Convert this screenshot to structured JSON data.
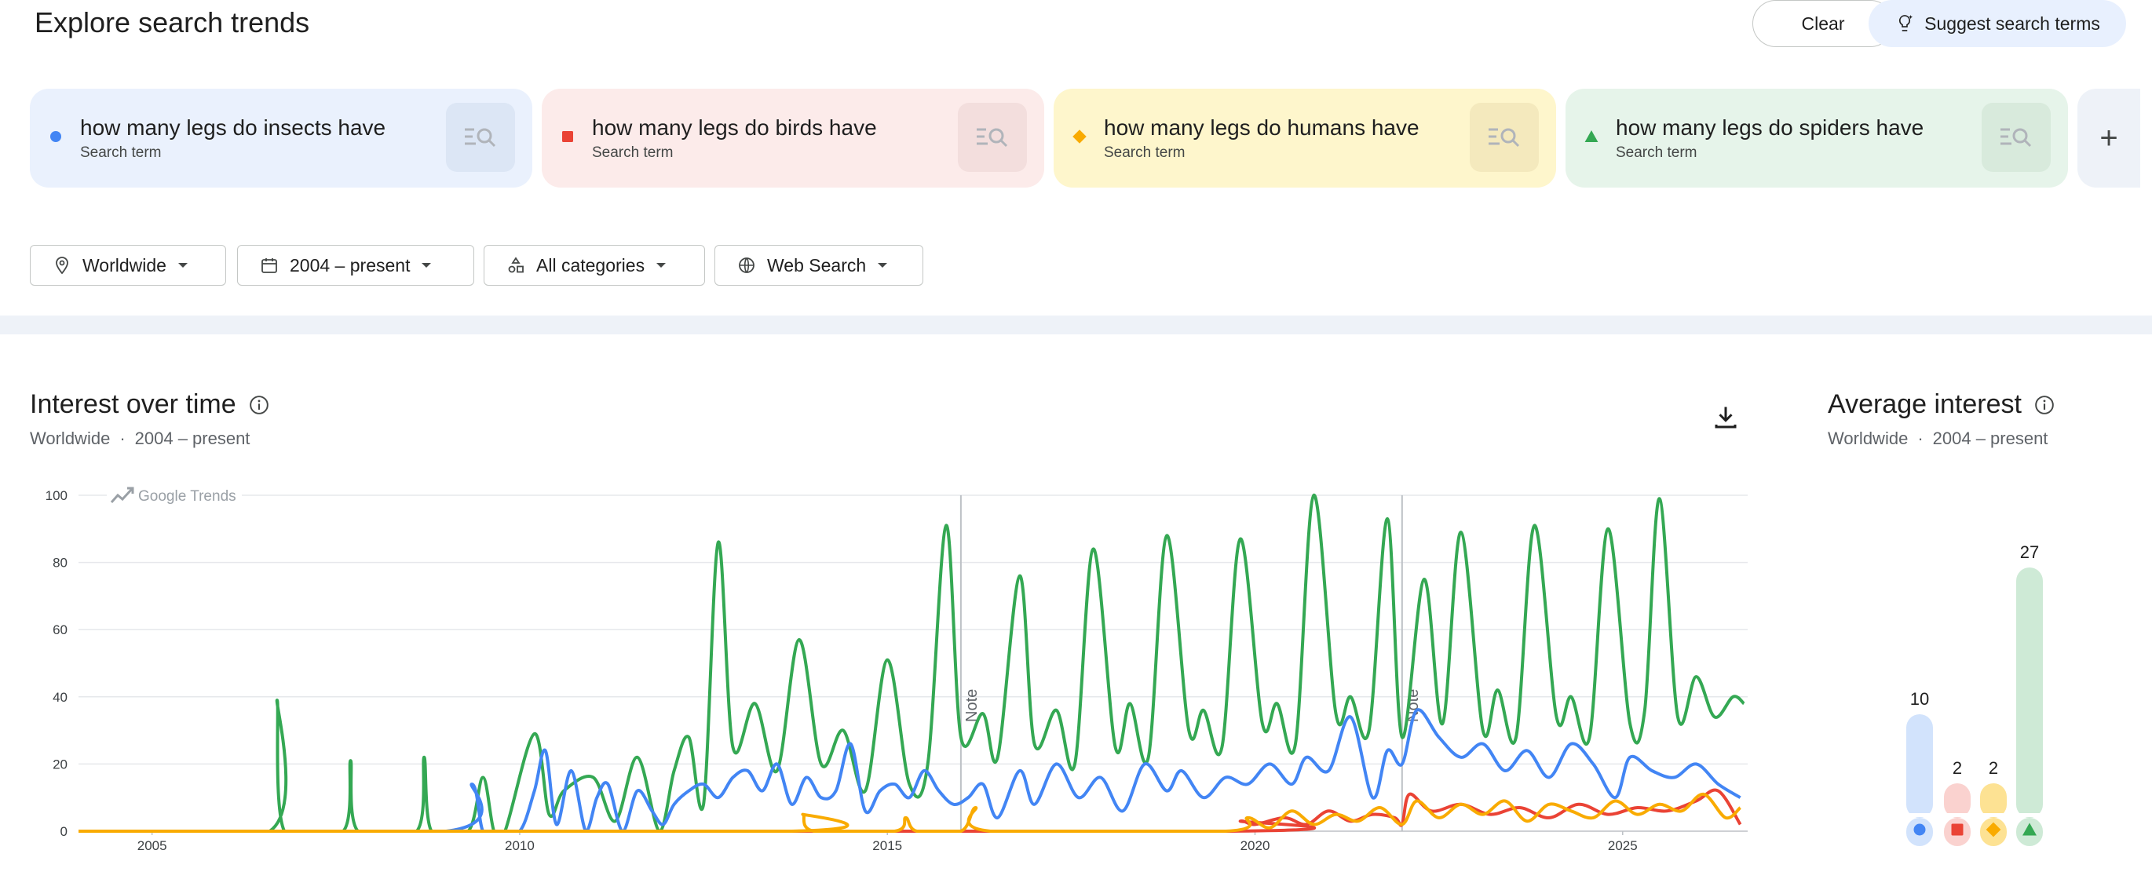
{
  "header": {
    "title": "Explore search trends",
    "clear_label": "Clear",
    "suggest_label": "Suggest search terms"
  },
  "terms": [
    {
      "label": "how many legs do insects have",
      "sub": "Search term",
      "color": "#4285f4",
      "bg": "#eaf1fd",
      "tile": "#dce6f5",
      "marker": "circle"
    },
    {
      "label": "how many legs do birds have",
      "sub": "Search term",
      "color": "#ea4335",
      "bg": "#fcebea",
      "tile": "#f3dedd",
      "marker": "square"
    },
    {
      "label": "how many legs do humans have",
      "sub": "Search term",
      "color": "#f9ab00",
      "bg": "#fef6cc",
      "tile": "#f4e9bd",
      "marker": "diamond"
    },
    {
      "label": "how many legs do spiders have",
      "sub": "Search term",
      "color": "#34a853",
      "bg": "#e6f4ea",
      "tile": "#d8eadc",
      "marker": "triangle"
    }
  ],
  "filters": {
    "location": "Worldwide",
    "time": "2004 – present",
    "category": "All categories",
    "property": "Web Search"
  },
  "interest_over_time": {
    "title": "Interest over time",
    "subtitle_location": "Worldwide",
    "subtitle_sep": "·",
    "subtitle_time": "2004 – present",
    "watermark": "Google Trends"
  },
  "average_interest": {
    "title": "Average interest",
    "subtitle_location": "Worldwide",
    "subtitle_sep": "·",
    "subtitle_time": "2004 – present"
  },
  "chart_data": [
    {
      "type": "line",
      "title": "Interest over time",
      "ylim": [
        0,
        100
      ],
      "yticks": [
        0,
        20,
        40,
        60,
        80,
        100
      ],
      "xlim": [
        2004.0,
        2026.7
      ],
      "xticks": [
        2005,
        2010,
        2015,
        2020,
        2025
      ],
      "grid": true,
      "notes": [
        {
          "x": 2016.0,
          "label": "Note"
        },
        {
          "x": 2022.0,
          "label": "Note"
        }
      ],
      "series": [
        {
          "name": "how many legs do insects have",
          "color": "#4285f4",
          "x": [
            2004.0,
            2009.0,
            2009.35,
            2009.5,
            2009.7,
            2010.0,
            2010.2,
            2010.35,
            2010.5,
            2010.7,
            2010.9,
            2011.05,
            2011.2,
            2011.4,
            2011.6,
            2011.8,
            2011.95,
            2012.1,
            2012.3,
            2012.5,
            2012.7,
            2012.9,
            2013.1,
            2013.3,
            2013.5,
            2013.7,
            2013.9,
            2014.1,
            2014.3,
            2014.5,
            2014.7,
            2014.9,
            2015.1,
            2015.3,
            2015.5,
            2015.7,
            2015.9,
            2016.1,
            2016.3,
            2016.5,
            2016.8,
            2017.0,
            2017.3,
            2017.6,
            2017.9,
            2018.2,
            2018.5,
            2018.8,
            2019.0,
            2019.3,
            2019.6,
            2019.9,
            2020.2,
            2020.5,
            2020.7,
            2021.0,
            2021.3,
            2021.6,
            2021.8,
            2022.0,
            2022.2,
            2022.5,
            2022.8,
            2023.1,
            2023.4,
            2023.7,
            2024.0,
            2024.3,
            2024.6,
            2024.9,
            2025.1,
            2025.4,
            2025.7,
            2026.0,
            2026.3,
            2026.6
          ],
          "y": [
            0,
            0,
            14,
            0,
            0,
            0,
            12,
            24,
            2,
            18,
            0,
            10,
            14,
            0,
            12,
            6,
            2,
            8,
            12,
            14,
            10,
            16,
            18,
            12,
            20,
            8,
            16,
            10,
            12,
            26,
            6,
            12,
            14,
            10,
            18,
            12,
            8,
            10,
            14,
            4,
            18,
            8,
            20,
            10,
            16,
            6,
            20,
            12,
            18,
            10,
            16,
            14,
            20,
            14,
            22,
            18,
            34,
            10,
            24,
            20,
            36,
            28,
            22,
            26,
            18,
            24,
            16,
            26,
            20,
            10,
            22,
            18,
            16,
            20,
            14,
            10
          ]
        },
        {
          "name": "how many legs do birds have",
          "color": "#ea4335",
          "x": [
            2004.0,
            2019.6,
            2019.8,
            2020.0,
            2020.4,
            2020.7,
            2021.0,
            2021.3,
            2021.6,
            2021.9,
            2022.0,
            2022.1,
            2022.4,
            2022.8,
            2023.2,
            2023.6,
            2024.0,
            2024.4,
            2024.8,
            2025.2,
            2025.6,
            2026.0,
            2026.3,
            2026.6
          ],
          "y": [
            0,
            0,
            3,
            2,
            4,
            2,
            6,
            3,
            5,
            4,
            2,
            11,
            6,
            8,
            5,
            7,
            4,
            8,
            5,
            7,
            6,
            9,
            12,
            2
          ]
        },
        {
          "name": "how many legs do humans have",
          "color": "#f9ab00",
          "x": [
            2004.0,
            2013.7,
            2013.85,
            2014.0,
            2015.1,
            2015.25,
            2015.4,
            2016.0,
            2016.2,
            2016.4,
            2019.6,
            2019.9,
            2020.2,
            2020.5,
            2020.8,
            2021.1,
            2021.4,
            2021.7,
            2022.0,
            2022.2,
            2022.5,
            2022.8,
            2023.1,
            2023.4,
            2023.7,
            2024.0,
            2024.3,
            2024.6,
            2024.9,
            2025.2,
            2025.5,
            2025.8,
            2026.1,
            2026.4,
            2026.6
          ],
          "y": [
            0,
            0,
            5,
            0,
            0,
            4,
            0,
            0,
            7,
            0,
            0,
            4,
            1,
            6,
            2,
            5,
            3,
            7,
            2,
            9,
            4,
            8,
            5,
            9,
            3,
            8,
            6,
            4,
            9,
            5,
            8,
            6,
            11,
            4,
            7
          ]
        },
        {
          "name": "how many legs do spiders have",
          "color": "#34a853",
          "x": [
            2004.0,
            2006.6,
            2006.7,
            2006.8,
            2007.6,
            2007.7,
            2007.8,
            2008.6,
            2008.7,
            2008.8,
            2009.3,
            2009.5,
            2009.65,
            2009.8,
            2010.2,
            2010.4,
            2010.6,
            2011.0,
            2011.3,
            2011.6,
            2011.9,
            2012.1,
            2012.3,
            2012.5,
            2012.7,
            2012.9,
            2013.2,
            2013.5,
            2013.8,
            2014.1,
            2014.4,
            2014.7,
            2015.0,
            2015.3,
            2015.55,
            2015.8,
            2016.0,
            2016.3,
            2016.5,
            2016.8,
            2017.0,
            2017.3,
            2017.55,
            2017.8,
            2018.1,
            2018.3,
            2018.55,
            2018.8,
            2019.1,
            2019.3,
            2019.55,
            2019.8,
            2020.1,
            2020.3,
            2020.55,
            2020.8,
            2021.1,
            2021.3,
            2021.55,
            2021.8,
            2022.0,
            2022.3,
            2022.55,
            2022.8,
            2023.1,
            2023.3,
            2023.55,
            2023.8,
            2024.1,
            2024.3,
            2024.55,
            2024.8,
            2025.1,
            2025.3,
            2025.5,
            2025.75,
            2026.0,
            2026.25,
            2026.5,
            2026.65
          ],
          "y": [
            0,
            0,
            39,
            0,
            0,
            21,
            0,
            0,
            22,
            0,
            0,
            16,
            0,
            0,
            29,
            5,
            12,
            16,
            3,
            22,
            0,
            18,
            28,
            8,
            86,
            25,
            38,
            18,
            57,
            20,
            30,
            12,
            51,
            14,
            20,
            91,
            28,
            35,
            22,
            76,
            26,
            36,
            20,
            84,
            25,
            38,
            22,
            88,
            30,
            36,
            25,
            87,
            32,
            38,
            26,
            100,
            35,
            40,
            30,
            93,
            28,
            75,
            32,
            89,
            30,
            42,
            28,
            91,
            34,
            40,
            28,
            90,
            32,
            36,
            99,
            34,
            46,
            34,
            40,
            38
          ]
        }
      ]
    },
    {
      "type": "bar",
      "title": "Average interest",
      "categories": [
        "how many legs do insects have",
        "how many legs do birds have",
        "how many legs do humans have",
        "how many legs do spiders have"
      ],
      "values": [
        10,
        2,
        2,
        27
      ],
      "colors": [
        "#4285f4",
        "#ea4335",
        "#f9ab00",
        "#34a853"
      ]
    }
  ]
}
